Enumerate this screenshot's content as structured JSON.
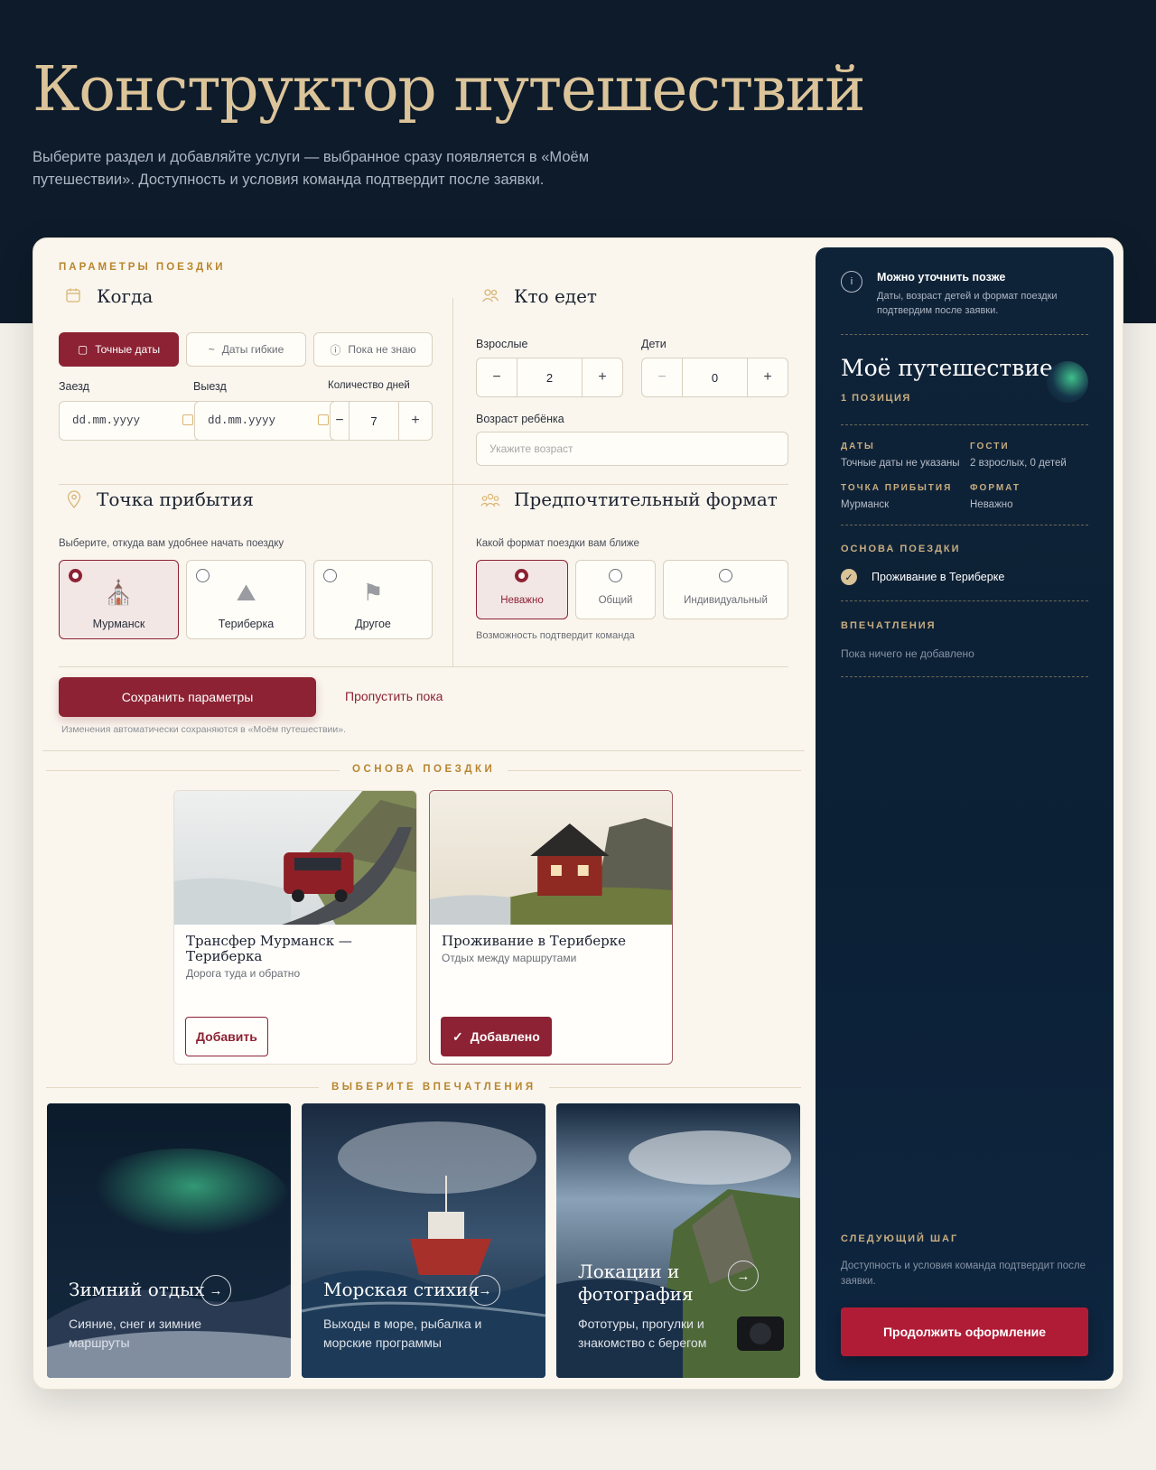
{
  "header": {
    "title": "Конструктор путешествий",
    "subtitle": "Выберите раздел и добавляйте услуги — выбранное сразу появляется в «Моём путешествии». Доступность и условия команда подтвердит после заявки."
  },
  "params": {
    "section_label": "ПАРАМЕТРЫ ПОЕЗДКИ",
    "when": {
      "title": "Когда",
      "modes": [
        "Точные даты",
        "Даты гибкие",
        "Пока не знаю"
      ],
      "checkin_label": "Заезд",
      "checkout_label": "Выезд",
      "days_label": "Количество дней",
      "date_placeholder": "dd.mm.yyyy",
      "days_value": "7",
      "minus": "−",
      "plus": "+"
    },
    "who": {
      "title": "Кто едет",
      "adults_label": "Взрослые",
      "adults_value": "2",
      "children_label": "Дети",
      "children_value": "0",
      "child_age_label": "Возраст ребёнка",
      "child_age_placeholder": "Укажите возраст"
    },
    "arrival": {
      "title": "Точка прибытия",
      "hint": "Выберите, откуда вам удобнее начать поездку",
      "options": [
        "Мурманск",
        "Териберка",
        "Другое"
      ]
    },
    "format": {
      "title": "Предпочтительный формат",
      "hint": "Какой формат поездки вам ближе",
      "options": [
        "Неважно",
        "Общий",
        "Индивидуальный"
      ],
      "note": "Возможность подтвердит команда"
    },
    "save_label": "Сохранить параметры",
    "skip_label": "Пропустить пока",
    "autosave_note": "Изменения автоматически сохраняются в «Моём путешествии»."
  },
  "base": {
    "section_label": "ОСНОВА ПОЕЗДКИ",
    "cards": [
      {
        "title": "Трансфер Мурманск — Териберка",
        "subtitle": "Дорога туда и обратно",
        "button": "Добавить"
      },
      {
        "title": "Проживание в Териберке",
        "subtitle": "Отдых между маршрутами",
        "button": "Добавлено"
      }
    ]
  },
  "experiences": {
    "section_label": "ВЫБЕРИТЕ ВПЕЧАТЛЕНИЯ",
    "cards": [
      {
        "title": "Зимний отдых",
        "subtitle": "Сияние, снег и зимние маршруты"
      },
      {
        "title": "Морская стихия",
        "subtitle": "Выходы в море, рыбалка и морские программы"
      },
      {
        "title": "Локации и фотография",
        "subtitle": "Фототуры, прогулки и знакомство с берегом"
      }
    ]
  },
  "sidebar": {
    "info_icon": "i",
    "info_title": "Можно уточнить позже",
    "info_text": "Даты, возраст детей и формат поездки подтвердим после заявки.",
    "title": "Моё путешествие",
    "count": "1 ПОЗИЦИЯ",
    "dates_label": "ДАТЫ",
    "dates_value": "Точные даты не указаны",
    "guests_label": "ГОСТИ",
    "guests_value": "2 взрослых, 0 детей",
    "arrival_label": "ТОЧКА ПРИБЫТИЯ",
    "arrival_value": "Мурманск",
    "format_label": "ФОРМАТ",
    "format_value": "Неважно",
    "base_label": "ОСНОВА ПОЕЗДКИ",
    "base_item": "Проживание в Териберке",
    "exp_label": "ВПЕЧАТЛЕНИЯ",
    "exp_empty": "Пока ничего не добавлено",
    "next_label": "СЛЕДУЮЩИЙ ШАГ",
    "next_text": "Доступность и условия команда подтвердит после заявки.",
    "continue_label": "Продолжить оформление"
  },
  "colors": {
    "accent": "#8c2233",
    "gold": "#b8852f",
    "navy": "#0d1b2a",
    "cream": "#faf6ee"
  },
  "icons": {
    "when": "calendar-icon",
    "who": "people-icon",
    "arrival": "map-pin-icon",
    "format": "group-icon",
    "murmansk": "church-icon",
    "teriberka": "landscape-icon",
    "other": "signpost-icon",
    "arrow": "arrow-right-icon",
    "check": "check-icon"
  }
}
